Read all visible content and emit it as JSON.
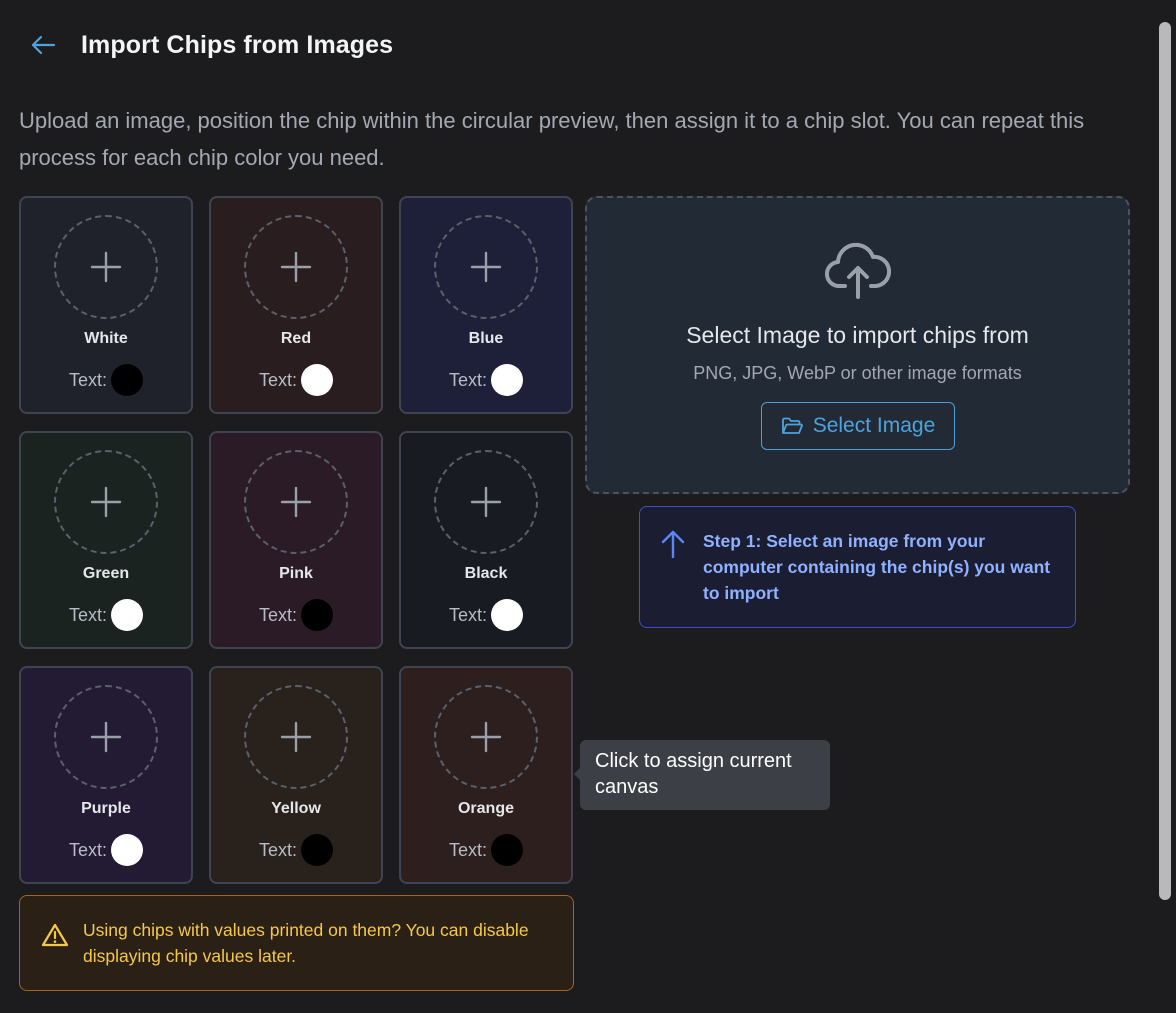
{
  "header": {
    "title": "Import Chips from Images"
  },
  "intro": "Upload an image, position the chip within the circular preview, then assign it to a chip slot. You can repeat this process for each chip color you need.",
  "text_label": "Text:",
  "chips": [
    {
      "name": "White",
      "tile_bg": "#1f222b",
      "text_color": "#000000"
    },
    {
      "name": "Red",
      "tile_bg": "#2a1d1f",
      "text_color": "#ffffff"
    },
    {
      "name": "Blue",
      "tile_bg": "#1e1f38",
      "text_color": "#ffffff"
    },
    {
      "name": "Green",
      "tile_bg": "#1a231f",
      "text_color": "#ffffff"
    },
    {
      "name": "Pink",
      "tile_bg": "#2a1b26",
      "text_color": "#000000"
    },
    {
      "name": "Black",
      "tile_bg": "#181b22",
      "text_color": "#ffffff"
    },
    {
      "name": "Purple",
      "tile_bg": "#231b33",
      "text_color": "#ffffff"
    },
    {
      "name": "Yellow",
      "tile_bg": "#28211c",
      "text_color": "#000000"
    },
    {
      "name": "Orange",
      "tile_bg": "#2c1f1e",
      "text_color": "#000000"
    }
  ],
  "uploader": {
    "title": "Select Image to import chips from",
    "subtitle": "PNG, JPG, WebP or other image formats",
    "button_label": "Select Image"
  },
  "step_hint": "Step 1: Select an image from your computer containing the chip(s) you want to import",
  "tooltip": "Click to assign current canvas",
  "warning": "Using chips with values printed on them? You can disable displaying chip values later.",
  "colors": {
    "accent": "#4fa3dc",
    "step_text": "#8fb1ff",
    "warning_text": "#f5c84a",
    "warning_border": "#a8631c"
  },
  "icons": {
    "back": "arrow-left-icon",
    "slot": "plus-icon",
    "upload": "cloud-upload-icon",
    "folder": "folder-open-icon",
    "step": "arrow-up-icon",
    "warning": "warning-triangle-icon"
  }
}
